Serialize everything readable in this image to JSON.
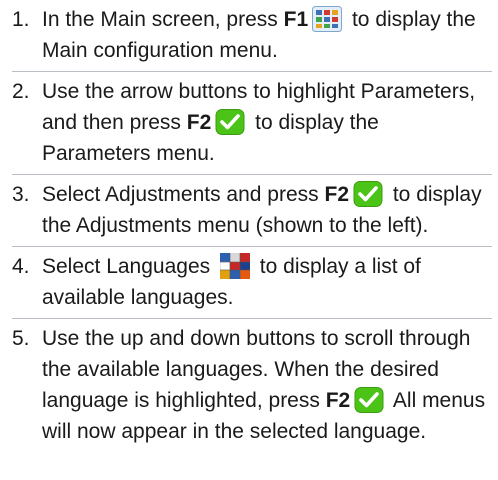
{
  "steps": [
    {
      "num": "1.",
      "text_a": "In the Main screen, press ",
      "key": "F1",
      "text_b": " to display the Main configuration menu.",
      "icon": "main-config-icon"
    },
    {
      "num": "2.",
      "text_a": "Use the arrow buttons to highlight Parameters, and then press ",
      "key": "F2",
      "text_b": " to display the Parameters menu.",
      "icon": "checkmark-icon"
    },
    {
      "num": "3.",
      "text_a": "Select Adjustments and press ",
      "key": "F2",
      "text_b": " to display the Adjustments menu (shown to the left).",
      "icon": "checkmark-icon"
    },
    {
      "num": "4.",
      "text_a": "Select Languages ",
      "text_b": " to display a list of available languages.",
      "icon": "languages-icon"
    },
    {
      "num": "5.",
      "text_a": "Use the up and down buttons to scroll through the available languages. When the desired language is highlighted, press ",
      "key": "F2",
      "text_b": " All menus will now appear in the selected language.",
      "icon": "checkmark-icon"
    }
  ],
  "colors": {
    "check_green": "#4cc417",
    "divider": "#b9bec4",
    "text": "#1a1a1a"
  }
}
